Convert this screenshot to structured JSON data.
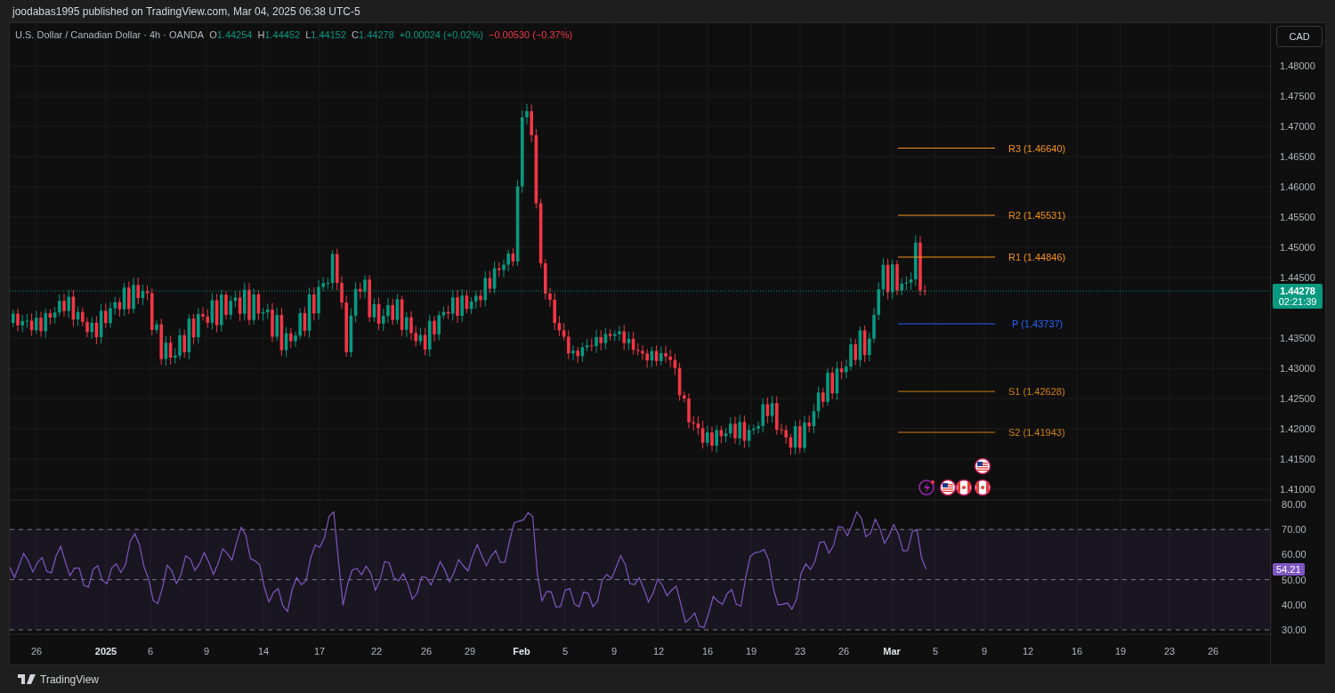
{
  "header": {
    "publisher_line": "joodabas1995 published on TradingView.com, Mar 04, 2025 06:38 UTC-5"
  },
  "legend": {
    "symbol": "U.S. Dollar / Canadian Dollar · 4h · OANDA",
    "ohlc": [
      {
        "label": "O",
        "value": "1.44254"
      },
      {
        "label": "H",
        "value": "1.44452"
      },
      {
        "label": "L",
        "value": "1.44152"
      },
      {
        "label": "C",
        "value": "1.44278"
      }
    ],
    "changes": [
      {
        "kind": "up",
        "text": "+0.00024 (+0.02%)"
      },
      {
        "kind": "down",
        "text": "−0.00530 (−0.37%)"
      }
    ]
  },
  "currency_button": "CAD",
  "pivot_levels": [
    {
      "label": "R3 (1.46640)",
      "color": "#f7931a"
    },
    {
      "label": "R2 (1.45531)",
      "color": "#f7931a"
    },
    {
      "label": "R1 (1.44846)",
      "color": "#f7931a"
    },
    {
      "label": "P (1.43737)",
      "color": "#2962ff"
    },
    {
      "label": "S1 (1.42628)",
      "color": "#d1800f"
    },
    {
      "label": "S2 (1.41943)",
      "color": "#d1800f"
    }
  ],
  "price_axis": {
    "ticks": [
      "1.48000",
      "1.47500",
      "1.47000",
      "1.46500",
      "1.46000",
      "1.45500",
      "1.45000",
      "1.44500",
      "1.43500",
      "1.43000",
      "1.42500",
      "1.42000",
      "1.41500",
      "1.41000"
    ],
    "last_price": "1.44278",
    "countdown": "02:21:39"
  },
  "rsi": {
    "axis_ticks": [
      "80.00",
      "70.00",
      "60.00",
      "50.00",
      "40.00",
      "30.00"
    ],
    "value": "54.21"
  },
  "time_axis": [
    {
      "label": "26",
      "major": false
    },
    {
      "label": "2025",
      "major": true
    },
    {
      "label": "6",
      "major": false
    },
    {
      "label": "9",
      "major": false
    },
    {
      "label": "14",
      "major": false
    },
    {
      "label": "17",
      "major": false
    },
    {
      "label": "22",
      "major": false
    },
    {
      "label": "26",
      "major": false
    },
    {
      "label": "29",
      "major": false
    },
    {
      "label": "Feb",
      "major": true
    },
    {
      "label": "5",
      "major": false
    },
    {
      "label": "9",
      "major": false
    },
    {
      "label": "12",
      "major": false
    },
    {
      "label": "16",
      "major": false
    },
    {
      "label": "19",
      "major": false
    },
    {
      "label": "23",
      "major": false
    },
    {
      "label": "26",
      "major": false
    },
    {
      "label": "Mar",
      "major": true
    },
    {
      "label": "5",
      "major": false
    },
    {
      "label": "9",
      "major": false
    },
    {
      "label": "12",
      "major": false
    },
    {
      "label": "16",
      "major": false
    },
    {
      "label": "19",
      "major": false
    },
    {
      "label": "23",
      "major": false
    },
    {
      "label": "26",
      "major": false
    }
  ],
  "footer": {
    "brand": "TradingView"
  }
}
